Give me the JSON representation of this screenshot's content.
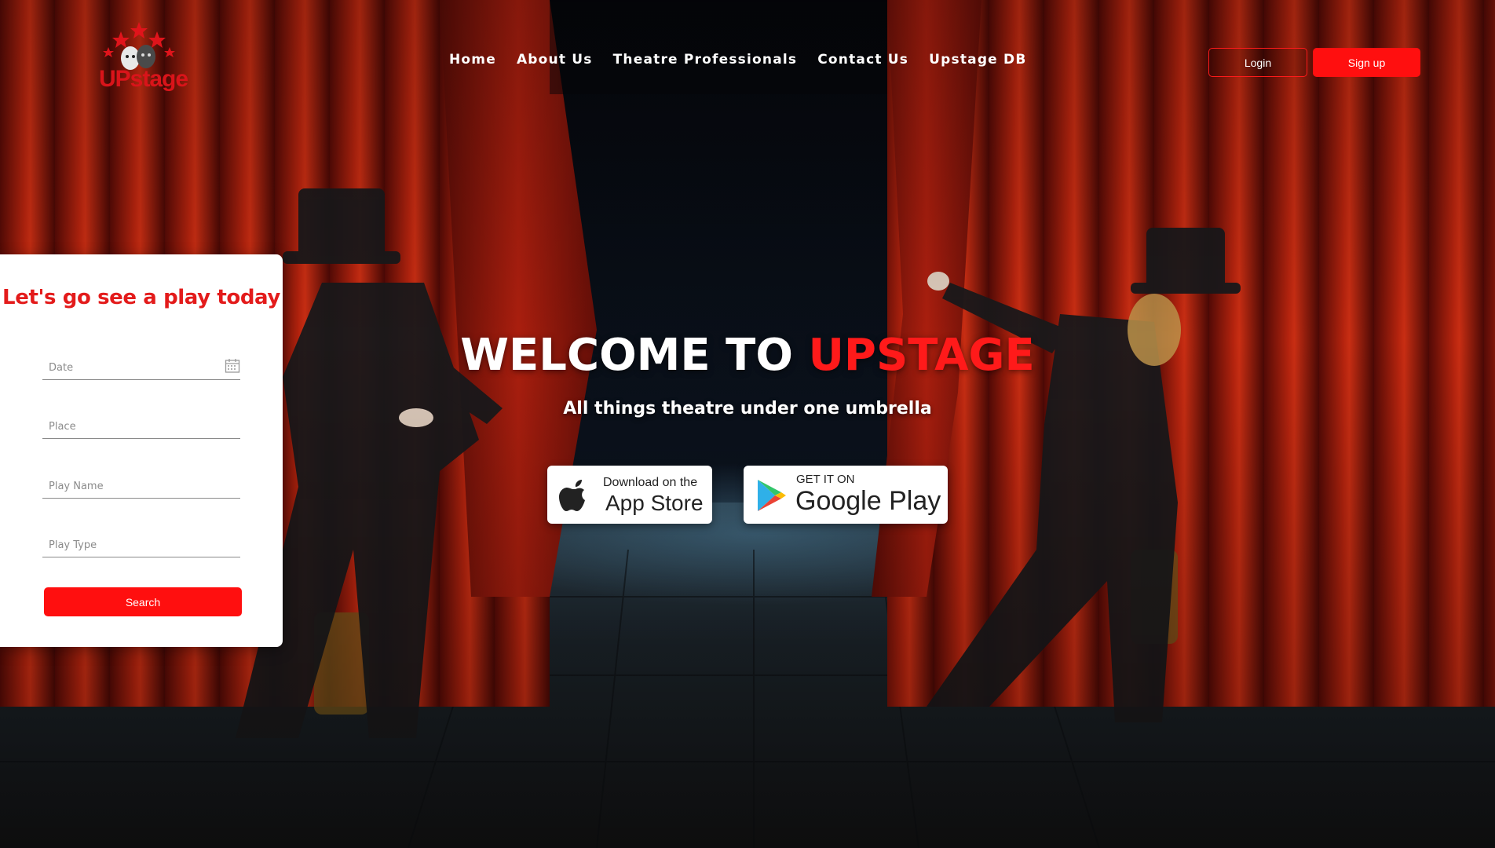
{
  "header": {
    "logo_text": "UPstage",
    "nav": [
      "Home",
      "About Us",
      "Theatre Professionals",
      "Contact Us",
      "Upstage DB"
    ],
    "login_label": "Login",
    "signup_label": "Sign up"
  },
  "search_card": {
    "title": "Let's go see a play today",
    "fields": {
      "date": "Date",
      "place": "Place",
      "play_name": "Play Name",
      "play_type": "Play Type"
    },
    "search_label": "Search"
  },
  "hero": {
    "title_prefix": "WELCOME TO ",
    "title_accent": "UPSTAGE",
    "subtitle": "All things theatre under one umbrella"
  },
  "badges": {
    "apple": {
      "small": "Download on the",
      "big": "App Store",
      "icon": "apple-icon"
    },
    "google": {
      "small": "GET IT ON",
      "big": "Google Play",
      "icon": "google-play-icon"
    }
  },
  "colors": {
    "accent": "#ff0f0f",
    "title_red": "#e31b1b",
    "curtain": "#a3180f"
  }
}
